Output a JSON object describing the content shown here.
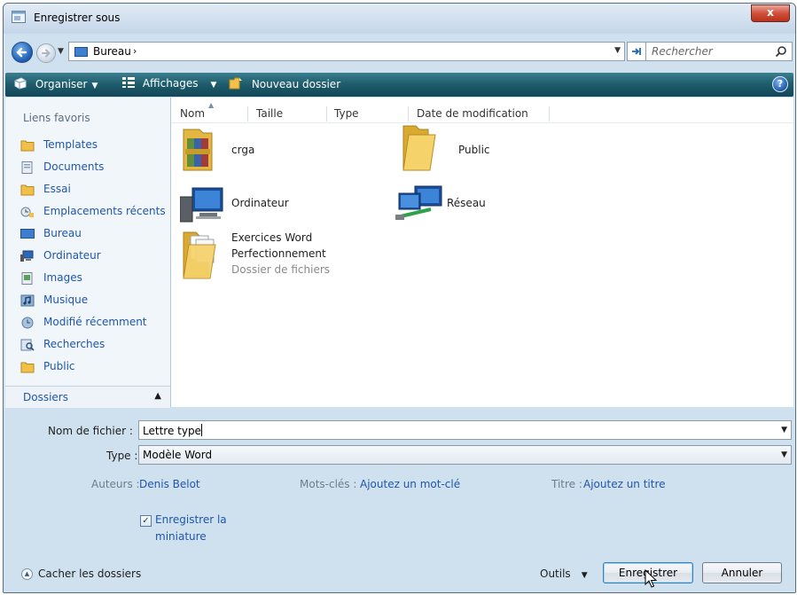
{
  "window": {
    "title": "Enregistrer sous",
    "close_glyph": "x"
  },
  "address": {
    "location": "Bureau",
    "separator": "›",
    "search_placeholder": "Rechercher"
  },
  "toolbar": {
    "organize": "Organiser",
    "views": "Affichages",
    "new_folder": "Nouveau dossier",
    "help_glyph": "?"
  },
  "favorites": {
    "header": "Liens favoris",
    "items": [
      {
        "label": "Templates",
        "icon": "folder-icon"
      },
      {
        "label": "Documents",
        "icon": "documents-icon"
      },
      {
        "label": "Essai",
        "icon": "folder-icon"
      },
      {
        "label": "Emplacements récents",
        "icon": "recent-places-icon"
      },
      {
        "label": "Bureau",
        "icon": "desktop-icon"
      },
      {
        "label": "Ordinateur",
        "icon": "computer-icon"
      },
      {
        "label": "Images",
        "icon": "pictures-icon"
      },
      {
        "label": "Musique",
        "icon": "music-icon"
      },
      {
        "label": "Modifié récemment",
        "icon": "recently-changed-icon"
      },
      {
        "label": "Recherches",
        "icon": "searches-icon"
      },
      {
        "label": "Public",
        "icon": "folder-icon"
      }
    ],
    "folders_label": "Dossiers"
  },
  "columns": [
    "Nom",
    "Taille",
    "Type",
    "Date de modification"
  ],
  "files": [
    {
      "name": "crga",
      "icon": "winrar-folder-icon"
    },
    {
      "name": "Public",
      "icon": "folder-icon"
    },
    {
      "name": "Ordinateur",
      "icon": "computer-icon"
    },
    {
      "name": "Réseau",
      "icon": "network-icon"
    },
    {
      "name_line1": "Exercices Word",
      "name_line2": "Perfectionnement",
      "subtitle": "Dossier de fichiers",
      "icon": "folder-with-papers-icon"
    }
  ],
  "form": {
    "filename_label": "Nom de fichier :",
    "filename_value": "Lettre type",
    "type_label": "Type :",
    "type_value": "Modèle Word",
    "authors_label": "Auteurs :",
    "authors_value": "Denis Belot",
    "keywords_label": "Mots-clés :",
    "keywords_value": "Ajoutez un mot-clé",
    "title_label": "Titre :",
    "title_value": "Ajoutez un titre",
    "thumbnail_line1": "Enregistrer la",
    "thumbnail_line2": "miniature",
    "thumbnail_checked": true,
    "check_glyph": "✓"
  },
  "footer": {
    "hide_folders": "Cacher les dossiers",
    "tools": "Outils",
    "save": "Enregistrer",
    "cancel": "Annuler"
  }
}
